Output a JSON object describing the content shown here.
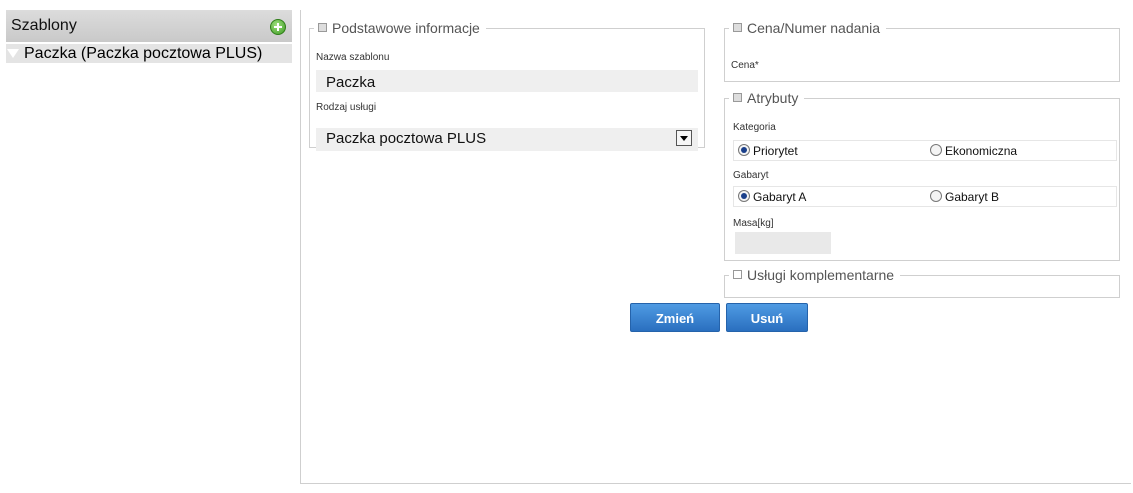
{
  "sidebar": {
    "title": "Szablony",
    "add_icon": "plus-circle-icon",
    "items": [
      {
        "label": "Paczka (Paczka pocztowa PLUS)"
      }
    ]
  },
  "basic_info": {
    "legend": "Podstawowe informacje",
    "template_name_label": "Nazwa szablonu",
    "template_name_value": "Paczka",
    "service_label": "Rodzaj usługi",
    "service_value": "Paczka pocztowa PLUS"
  },
  "price": {
    "legend": "Cena/Numer nadania",
    "price_label": "Cena*"
  },
  "attributes": {
    "legend": "Atrybuty",
    "category_label": "Kategoria",
    "category_options": [
      "Priorytet",
      "Ekonomiczna"
    ],
    "category_selected": "Priorytet",
    "size_label": "Gabaryt",
    "size_options": [
      "Gabaryt A",
      "Gabaryt B"
    ],
    "size_selected": "Gabaryt A",
    "mass_label": "Masa[kg]",
    "mass_value": ""
  },
  "extra_services": {
    "legend": "Usługi komplementarne"
  },
  "buttons": {
    "change": "Zmień",
    "delete": "Usuń"
  },
  "colors": {
    "button": "#2f7cd0",
    "sidebar_header": "#d3d3d3",
    "selected_item": "#e4e4e4"
  }
}
